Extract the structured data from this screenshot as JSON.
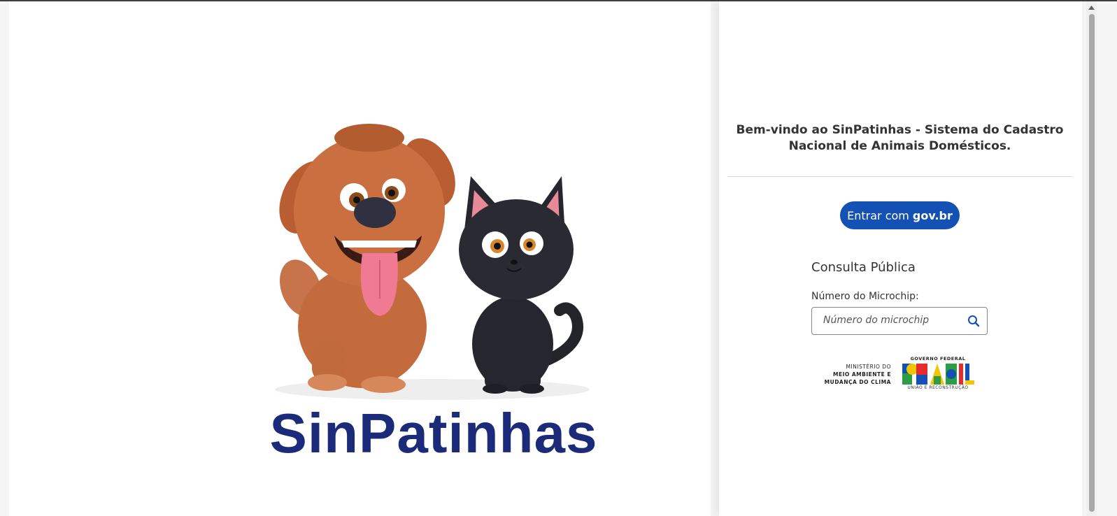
{
  "brand": {
    "name": "SinPatinhas"
  },
  "welcome_text": "Bem-vindo ao SinPatinhas - Sistema do Cadastro Nacional de Animais Domésticos.",
  "login": {
    "label_prefix": "Entrar com",
    "label_brand": "gov.br"
  },
  "consulta": {
    "title": "Consulta Pública",
    "field_label": "Número do Microchip:",
    "placeholder": "Número do microchip",
    "value": ""
  },
  "footer_logos": {
    "ministry": [
      "MINISTÉRIO DO",
      "MEIO AMBIENTE E",
      "MUDANÇA DO CLIMA"
    ],
    "gov_top": "GOVERNO FEDERAL",
    "gov_word": "BRASIL",
    "gov_bottom": "UNIÃO E RECONSTRUÇÃO"
  },
  "colors": {
    "primary_button": "#1351b4",
    "logo_text": "#1b2b7a"
  },
  "icons": [
    "dog-and-cat-illustration",
    "search-icon",
    "scroll-up-icon"
  ]
}
